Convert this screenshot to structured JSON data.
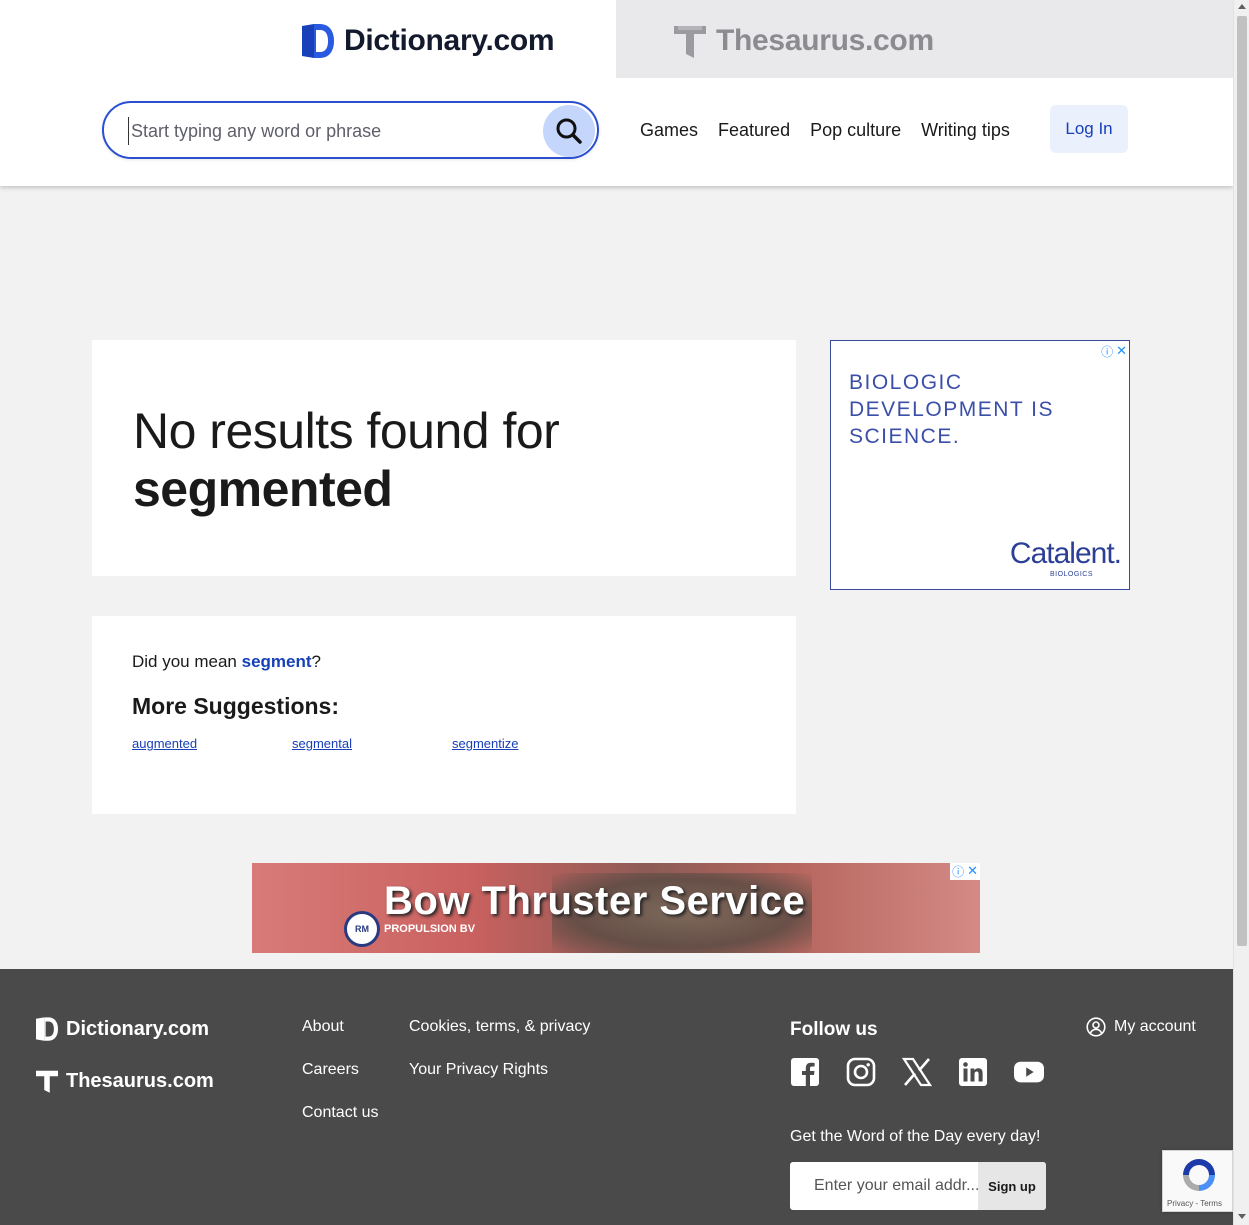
{
  "header": {
    "tabs": [
      {
        "label": "Dictionary.com",
        "active": true
      },
      {
        "label": "Thesaurus.com",
        "active": false
      }
    ],
    "search": {
      "placeholder": "Start typing any word or phrase"
    },
    "nav": [
      "Games",
      "Featured",
      "Pop culture",
      "Writing tips"
    ],
    "login_label": "Log In"
  },
  "results": {
    "title_prefix": "No results found for",
    "query": "segmented",
    "did_you_mean_prefix": "Did you mean",
    "did_you_mean_word": "segment",
    "did_you_mean_suffix": "?",
    "more_title": "More Suggestions:",
    "suggestions": [
      "augmented",
      "segmental",
      "segmentize"
    ]
  },
  "ads": {
    "side": {
      "lines": [
        "BIOLOGIC",
        "DEVELOPMENT IS",
        "SCIENCE."
      ],
      "brand": "Catalent.",
      "brand_sub": "BIOLOGICS"
    },
    "banner": {
      "headline": "Bow Thruster Service",
      "company": "PROPULSION BV",
      "logo_text": "RM"
    }
  },
  "footer": {
    "logos": [
      "Dictionary.com",
      "Thesaurus.com"
    ],
    "links_col1": [
      "About",
      "Careers",
      "Contact us"
    ],
    "links_col2": [
      "Cookies, terms, & privacy",
      "Your Privacy Rights"
    ],
    "follow_title": "Follow us",
    "socials": [
      "facebook-icon",
      "instagram-icon",
      "x-icon",
      "linkedin-icon",
      "youtube-icon"
    ],
    "wotd_text": "Get the Word of the Day every day!",
    "email_placeholder": "Enter your email addr...",
    "signup_label": "Sign up",
    "my_account_label": "My account"
  },
  "recaptcha": {
    "text": "Privacy - Terms"
  },
  "colors": {
    "accent": "#1740b9",
    "search_border": "#2a4fd1",
    "footer_bg": "#4a4a4a",
    "page_bg": "#f2f2f2"
  }
}
